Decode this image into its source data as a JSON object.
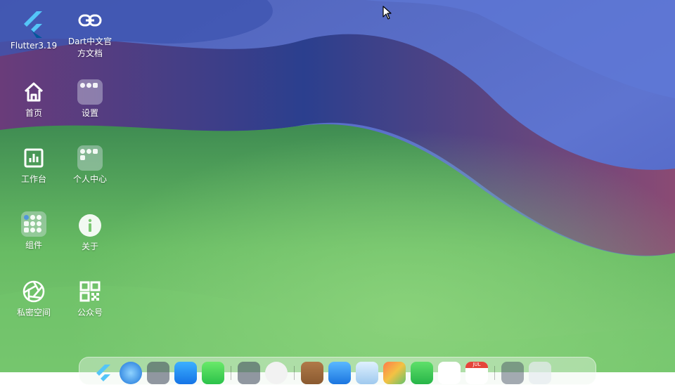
{
  "desktop": {
    "icons": [
      {
        "label": "Flutter3.19",
        "icon": "flutter-logo-icon"
      },
      {
        "label": "Dart中文官\n方文档",
        "icon": "link-icon"
      },
      {
        "label": "首页",
        "icon": "home-icon"
      },
      {
        "label": "设置",
        "icon": "folder-icon"
      },
      {
        "label": "工作台",
        "icon": "dashboard-icon"
      },
      {
        "label": "个人中心",
        "icon": "folder-icon"
      },
      {
        "label": "组件",
        "icon": "folder-icon"
      },
      {
        "label": "关于",
        "icon": "info-icon"
      },
      {
        "label": "私密空间",
        "icon": "aperture-icon"
      },
      {
        "label": "公众号",
        "icon": "qr-code-icon"
      }
    ]
  },
  "dock": {
    "items": [
      "flutter-icon",
      "safari-icon",
      "folder-icon",
      "app-store-icon",
      "messages-icon",
      "folder-icon",
      "chrome-icon",
      "briefcase-icon",
      "mail-icon",
      "phone-icon",
      "photos-icon",
      "facetime-icon",
      "music-icon",
      "calendar-icon",
      "folder-icon",
      "trash-icon"
    ],
    "calendar_month": "JUL"
  },
  "colors": {
    "wallpaper_top": "#4a5fc0",
    "wallpaper_band": "#7b3f6e",
    "wallpaper_green": "#6fc06a"
  }
}
